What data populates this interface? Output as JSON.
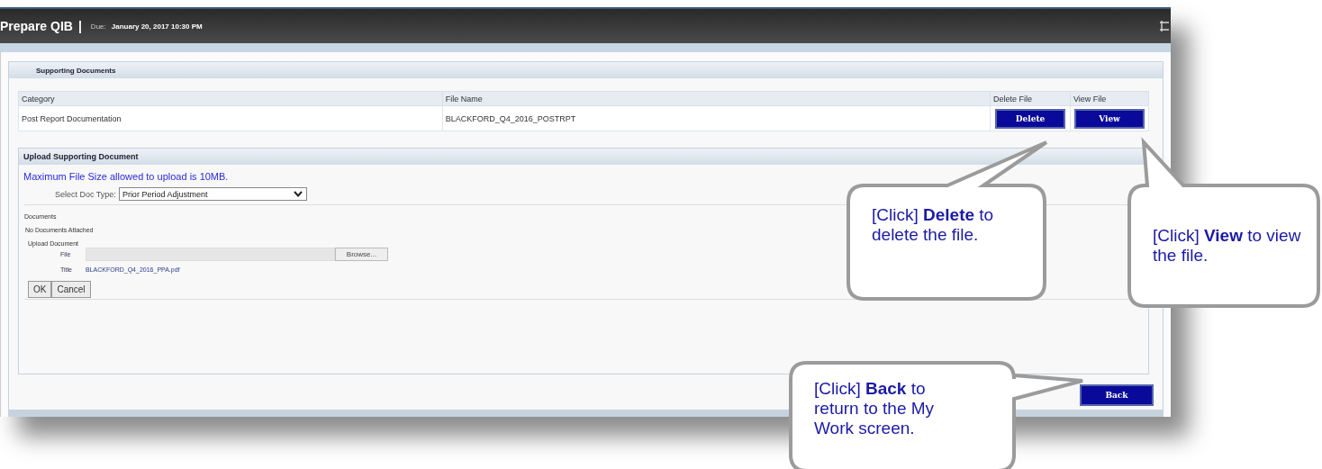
{
  "window": {
    "title": "Prepare QIB",
    "separator": "|",
    "due_label": "Due:",
    "due_date": "January 20, 2017 10:30 PM"
  },
  "supporting_documents": {
    "title": "Supporting Documents",
    "columns": [
      "Category",
      "File Name",
      "Delete File",
      "View File"
    ],
    "rows": [
      {
        "category": "Post Report Documentation",
        "file_name": "BLACKFORD_Q4_2016_POSTRPT",
        "delete_button": "Delete",
        "view_button": "View"
      }
    ]
  },
  "upload": {
    "title": "Upload Supporting Document",
    "notice": "Maximum File Size allowed to upload is 10MB.",
    "doc_type_label": "Select Doc Type:",
    "doc_type_value": "Prior Period Adjustment",
    "documents_label": "Documents",
    "documents_status": "No Documents Attached",
    "upload_label": "Upload Document",
    "file_label": "File",
    "browse_button": "Browse...",
    "title_label": "Title",
    "title_value": "BLACKFORD_Q4_2016_PPA.pdf",
    "buttons": [
      "OK",
      "Cancel"
    ]
  },
  "back_button": "Back",
  "callouts": [
    {
      "text": "[Click] **Delete** to delete the file."
    },
    {
      "text": "[Click] **View** to view the file."
    },
    {
      "text": "[Click] **Back** to return to the My Work screen."
    }
  ]
}
